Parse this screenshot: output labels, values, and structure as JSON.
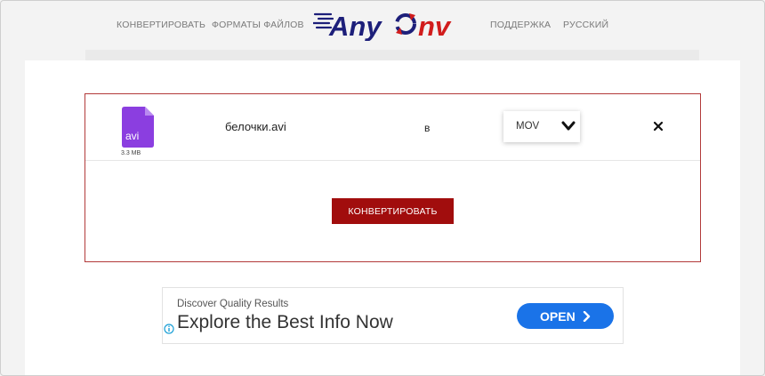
{
  "header": {
    "nav": [
      "КОНВЕРТИРОВАТЬ",
      "ФОРМАТЫ ФАЙЛОВ",
      "ПОДДЕРЖКА",
      "РУССКИЙ"
    ],
    "logo": "AnyConv"
  },
  "converter": {
    "file_name": "белочки.avi",
    "file_ext": "avi",
    "file_size": "3.3 MB",
    "to_label": "в",
    "format_value": "MOV",
    "convert_label": "КОНВЕРТИРОВАТЬ"
  },
  "ad": {
    "subtitle": "Discover Quality Results",
    "title": "Explore the Best Info Now",
    "button_label": "OPEN"
  },
  "colors": {
    "brand_red": "#a10d0d",
    "file_icon": "#8b3ee0",
    "ad_button": "#1a73e8"
  }
}
